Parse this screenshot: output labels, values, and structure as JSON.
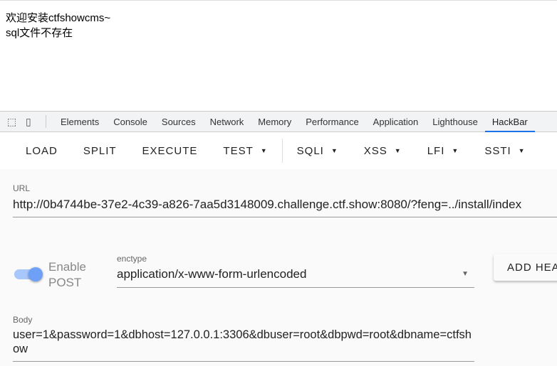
{
  "page": {
    "line1": "欢迎安装ctfshowcms~",
    "line2": "sql文件不存在"
  },
  "devtools": {
    "tabs": [
      "Elements",
      "Console",
      "Sources",
      "Network",
      "Memory",
      "Performance",
      "Application",
      "Lighthouse",
      "HackBar"
    ],
    "active_tab": "HackBar",
    "accent": "#1a73e8"
  },
  "hackbar": {
    "toolbar": {
      "load": "LOAD",
      "split": "SPLIT",
      "execute": "EXECUTE",
      "test": "TEST",
      "sqli": "SQLI",
      "xss": "XSS",
      "lfi": "LFI",
      "ssti": "SSTI"
    },
    "url": {
      "label": "URL",
      "value": "http://0b4744be-37e2-4c39-a826-7aa5d3148009.challenge.ctf.show:8080/?feng=../install/index"
    },
    "post": {
      "label1": "Enable",
      "label2": "POST",
      "enabled": true
    },
    "enctype": {
      "label": "enctype",
      "value": "application/x-www-form-urlencoded"
    },
    "add_header": "ADD HEADER",
    "body": {
      "label": "Body",
      "value": "user=1&password=1&dbhost=127.0.0.1:3306&dbuser=root&dbpwd=root&dbname=ctfshow"
    }
  }
}
